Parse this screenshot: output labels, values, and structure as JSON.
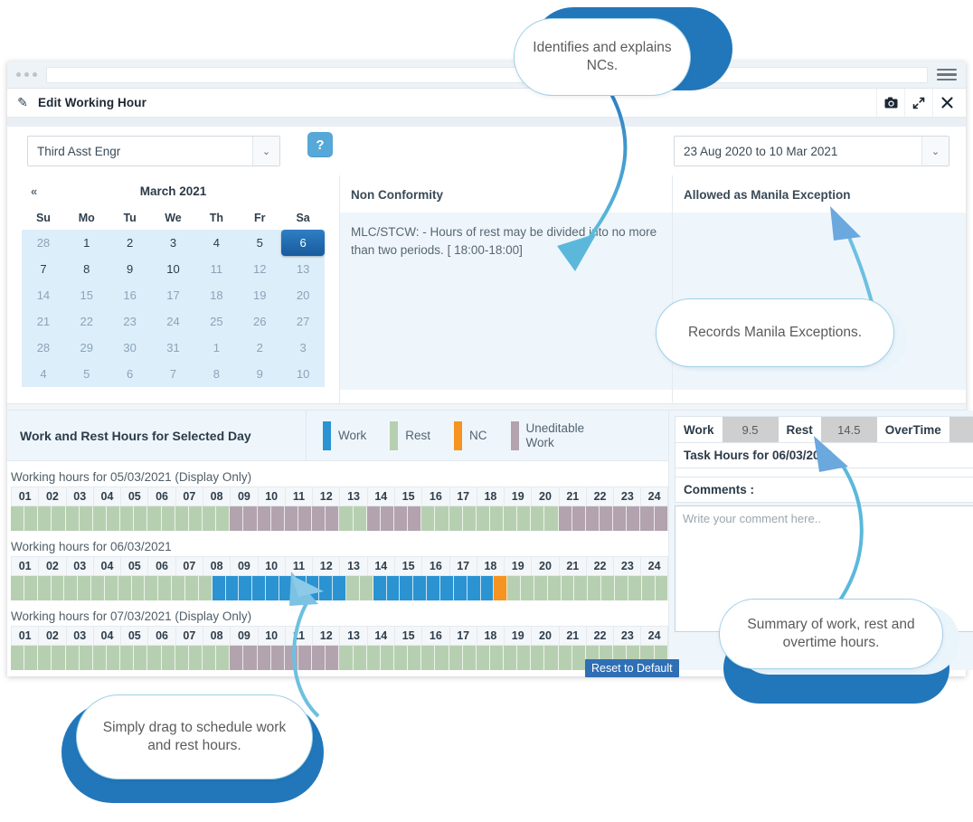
{
  "browser": {
    "dots_count": 3,
    "url_value": "",
    "menu_icon": "hamburger-icon"
  },
  "modal": {
    "title": "Edit Working Hour",
    "edit_icon": "pencil-square-icon",
    "actions": [
      {
        "name": "screenshot-button",
        "icon": "camera-icon",
        "glyph": "▣"
      },
      {
        "name": "expand-button",
        "icon": "expand-arrows-icon",
        "glyph": "⤢"
      },
      {
        "name": "close-button",
        "icon": "close-icon",
        "glyph": "✕"
      }
    ]
  },
  "filters": {
    "rank_value": "Third Asst Engr",
    "period_value": "23 Aug 2020 to 10 Mar 2021",
    "caret": "⌄",
    "help_label": "?"
  },
  "calendar": {
    "prev_label": "«",
    "title": "March 2021",
    "dow": [
      "Su",
      "Mo",
      "Tu",
      "We",
      "Th",
      "Fr",
      "Sa"
    ],
    "weeks": [
      [
        {
          "d": "28",
          "state": "muted"
        },
        {
          "d": "1",
          "state": "enabled"
        },
        {
          "d": "2",
          "state": "enabled"
        },
        {
          "d": "3",
          "state": "enabled"
        },
        {
          "d": "4",
          "state": "enabled"
        },
        {
          "d": "5",
          "state": "enabled"
        },
        {
          "d": "6",
          "state": "selected"
        }
      ],
      [
        {
          "d": "7",
          "state": "enabled"
        },
        {
          "d": "8",
          "state": "enabled"
        },
        {
          "d": "9",
          "state": "enabled"
        },
        {
          "d": "10",
          "state": "enabled"
        },
        {
          "d": "11",
          "state": "muted"
        },
        {
          "d": "12",
          "state": "muted"
        },
        {
          "d": "13",
          "state": "muted"
        }
      ],
      [
        {
          "d": "14",
          "state": "muted"
        },
        {
          "d": "15",
          "state": "muted"
        },
        {
          "d": "16",
          "state": "muted"
        },
        {
          "d": "17",
          "state": "muted"
        },
        {
          "d": "18",
          "state": "muted"
        },
        {
          "d": "19",
          "state": "muted"
        },
        {
          "d": "20",
          "state": "muted"
        }
      ],
      [
        {
          "d": "21",
          "state": "muted"
        },
        {
          "d": "22",
          "state": "muted"
        },
        {
          "d": "23",
          "state": "muted"
        },
        {
          "d": "24",
          "state": "muted"
        },
        {
          "d": "25",
          "state": "muted"
        },
        {
          "d": "26",
          "state": "muted"
        },
        {
          "d": "27",
          "state": "muted"
        }
      ],
      [
        {
          "d": "28",
          "state": "muted"
        },
        {
          "d": "29",
          "state": "muted"
        },
        {
          "d": "30",
          "state": "muted"
        },
        {
          "d": "31",
          "state": "muted"
        },
        {
          "d": "1",
          "state": "muted"
        },
        {
          "d": "2",
          "state": "muted"
        },
        {
          "d": "3",
          "state": "muted"
        }
      ],
      [
        {
          "d": "4",
          "state": "muted"
        },
        {
          "d": "5",
          "state": "muted"
        },
        {
          "d": "6",
          "state": "muted"
        },
        {
          "d": "7",
          "state": "muted"
        },
        {
          "d": "8",
          "state": "muted"
        },
        {
          "d": "9",
          "state": "muted"
        },
        {
          "d": "10",
          "state": "muted"
        }
      ]
    ]
  },
  "non_conformity": {
    "heading": "Non Conformity",
    "text": "MLC/STCW: - Hours of rest may be divided into no more than two periods. [ 18:00-18:00]"
  },
  "manila": {
    "heading": "Allowed as Manila Exception",
    "text": ""
  },
  "schedule": {
    "section_title": "Work and Rest Hours for Selected Day",
    "legend": [
      {
        "label": "Work",
        "color": "#2b93d1",
        "key": "work"
      },
      {
        "label": "Rest",
        "color": "#b7cfb1",
        "key": "rest"
      },
      {
        "label": "NC",
        "color": "#f5941f",
        "key": "nc"
      },
      {
        "label": "Uneditable Work",
        "color": "#b3a3ae",
        "key": "uneditable"
      }
    ],
    "hour_headers": [
      "01",
      "02",
      "03",
      "04",
      "05",
      "06",
      "07",
      "08",
      "09",
      "10",
      "11",
      "12",
      "13",
      "14",
      "15",
      "16",
      "17",
      "18",
      "19",
      "20",
      "21",
      "22",
      "23",
      "24"
    ],
    "reset_label": "Reset to Default",
    "days": [
      {
        "label": "Working hours for 05/03/2021 (Display Only)",
        "editable": false,
        "cells": [
          "rest",
          "rest",
          "rest",
          "rest",
          "rest",
          "rest",
          "rest",
          "rest",
          "rest",
          "rest",
          "rest",
          "rest",
          "rest",
          "rest",
          "rest",
          "rest",
          "uneditable",
          "uneditable",
          "uneditable",
          "uneditable",
          "uneditable",
          "uneditable",
          "uneditable",
          "uneditable",
          "rest",
          "rest",
          "uneditable",
          "uneditable",
          "uneditable",
          "uneditable",
          "rest",
          "rest",
          "rest",
          "rest",
          "rest",
          "rest",
          "rest",
          "rest",
          "rest",
          "rest",
          "uneditable",
          "uneditable",
          "uneditable",
          "uneditable",
          "uneditable",
          "uneditable",
          "uneditable",
          "uneditable"
        ]
      },
      {
        "label": "Working hours for 06/03/2021",
        "editable": true,
        "cells": [
          "rest",
          "rest",
          "rest",
          "rest",
          "rest",
          "rest",
          "rest",
          "rest",
          "rest",
          "rest",
          "rest",
          "rest",
          "rest",
          "rest",
          "rest",
          "work",
          "work",
          "work",
          "work",
          "work",
          "work",
          "work",
          "work",
          "work",
          "work",
          "rest",
          "rest",
          "work",
          "work",
          "work",
          "work",
          "work",
          "work",
          "work",
          "work",
          "work",
          "nc",
          "rest",
          "rest",
          "rest",
          "rest",
          "rest",
          "rest",
          "rest",
          "rest",
          "rest",
          "rest",
          "rest",
          "rest"
        ]
      },
      {
        "label": "Working hours for 07/03/2021 (Display Only)",
        "editable": false,
        "cells": [
          "rest",
          "rest",
          "rest",
          "rest",
          "rest",
          "rest",
          "rest",
          "rest",
          "rest",
          "rest",
          "rest",
          "rest",
          "rest",
          "rest",
          "rest",
          "rest",
          "uneditable",
          "uneditable",
          "uneditable",
          "uneditable",
          "uneditable",
          "uneditable",
          "uneditable",
          "uneditable",
          "rest",
          "rest",
          "rest",
          "rest",
          "rest",
          "rest",
          "rest",
          "rest",
          "rest",
          "rest",
          "rest",
          "rest",
          "rest",
          "rest",
          "rest",
          "rest",
          "rest",
          "rest",
          "rest",
          "rest",
          "rest",
          "rest",
          "rest",
          "rest"
        ]
      }
    ]
  },
  "summary": {
    "work_label": "Work",
    "work_value": "9.5",
    "rest_label": "Rest",
    "rest_value": "14.5",
    "overtime_label": "OverTime",
    "overtime_value": "",
    "task_hours_label": "Task Hours for 06/03/2021",
    "comments_label": "Comments :",
    "comment_value": "",
    "comment_placeholder": "Write your comment here.."
  },
  "callouts": {
    "nc": "Identifies and explains NCs.",
    "manila": "Records Manila Exceptions.",
    "summary": "Summary of work, rest and overtime hours.",
    "drag": "Simply drag to schedule work and rest hours."
  }
}
